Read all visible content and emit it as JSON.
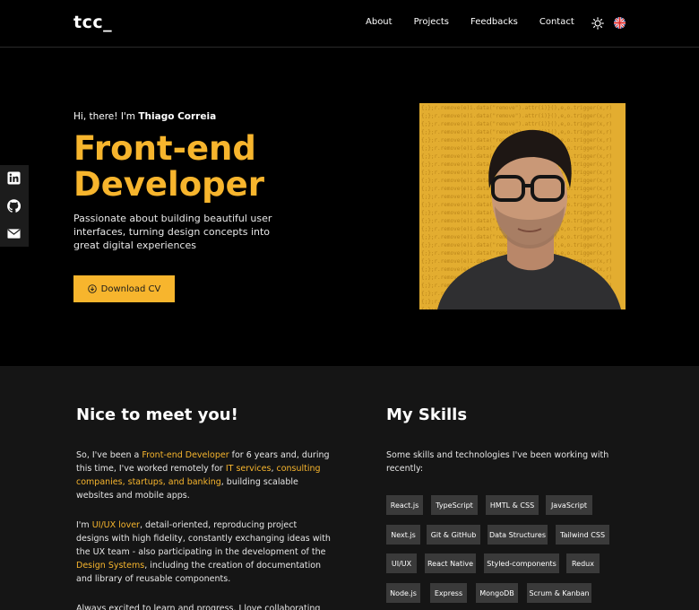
{
  "header": {
    "logo": "tcc_",
    "nav": [
      "About",
      "Projects",
      "Feedbacks",
      "Contact"
    ]
  },
  "hero": {
    "greeting_prefix": "Hi, there! I'm ",
    "name": "Thiago Correia",
    "title": "Front-end Developer",
    "description": "Passionate about building beautiful user interfaces, turning design concepts into great digital experiences",
    "cv_button": "Download CV"
  },
  "about": {
    "title": "Nice to meet you!",
    "p1": [
      "So, I've been a ",
      "Front-end Developer",
      " for 6 years and, during this time, I've worked remotely for ",
      "IT services",
      ", ",
      "consulting companies, startups, and banking",
      ", building scalable websites and mobile apps."
    ],
    "p2": [
      "I'm ",
      "UI/UX lover",
      ", detail-oriented, reproducing project designs with high fidelity, constantly exchanging ideas with the UX team - also participating in the development of the ",
      "Design Systems",
      ", including the creation of documentation and library of reusable components."
    ],
    "p3": "Always excited to learn and progress. I love collaborating and"
  },
  "skills": {
    "title": "My Skills",
    "intro": "Some skills and technologies I've been working with recently:",
    "items": [
      "React.js",
      "TypeScript",
      "HMTL & CSS",
      "JavaScript",
      "Next.js",
      "Git & GitHub",
      "Data Structures",
      "Tailwind CSS",
      "UI/UX",
      "React Native",
      "Styled-components",
      "Redux",
      "Node.js",
      "Express",
      "MongoDB",
      "Scrum & Kanban"
    ]
  },
  "colors": {
    "accent": "#f7b52d",
    "background": "#000000",
    "section": "#151515",
    "chip": "#3a3a3a"
  },
  "icons": [
    "sun-icon",
    "uk-flag-icon",
    "linkedin-icon",
    "github-icon",
    "mail-icon",
    "download-icon"
  ]
}
